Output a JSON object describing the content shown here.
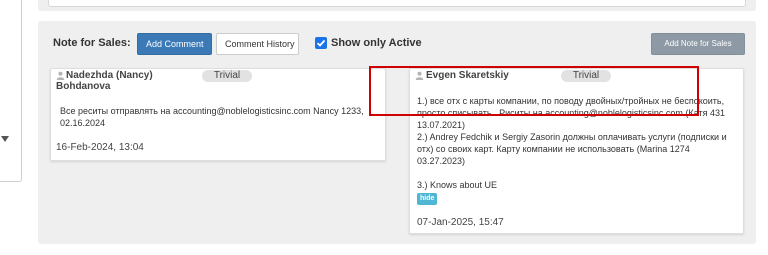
{
  "notes_section": {
    "label": "Note for Sales:",
    "add_comment_label": "Add Comment",
    "comment_history_label": "Comment History",
    "show_only_active_label": "Show only Active",
    "show_only_active_checked": true,
    "add_note_label": "Add Note for Sales"
  },
  "notes": [
    {
      "author_line1": "Nadezhda (Nancy)",
      "author_line2": "Bohdanova",
      "priority": "Trivial",
      "text": "Все реситы отправлять на accounting@noblelogisticsinc.com Nancy 1233, 02.16.2024",
      "date": "16-Feb-2024, 13:04",
      "author_icon": "user-icon"
    },
    {
      "author_line1": "Evgen Skaretskiy",
      "priority": "Trivial",
      "line1": "1.) все отх с карты компании, по поводу двойных/тройных не беспокоить, просто списывать . Риситы на accounting@noblelogisticsinc.com  (Катя 431 13.07.2021)",
      "line2": "2.) Andrey Fedchik и Sergiy Zasorin должны оплачивать услуги (подписки и отх) со своих карт. Карту компании не использовать (Marina 1274 03.27.2023)",
      "line3": "3.) Knows about UE",
      "hide_label": "hide",
      "date": "07-Jan-2025, 15:47",
      "author_icon": "user-icon"
    }
  ],
  "colors": {
    "primary_button": "#3b7ab7",
    "secondary_button": "#8d9aa5",
    "highlight": "#d00000",
    "checkbox": "#1a73e8",
    "hide_tag": "#4fb6d4"
  }
}
